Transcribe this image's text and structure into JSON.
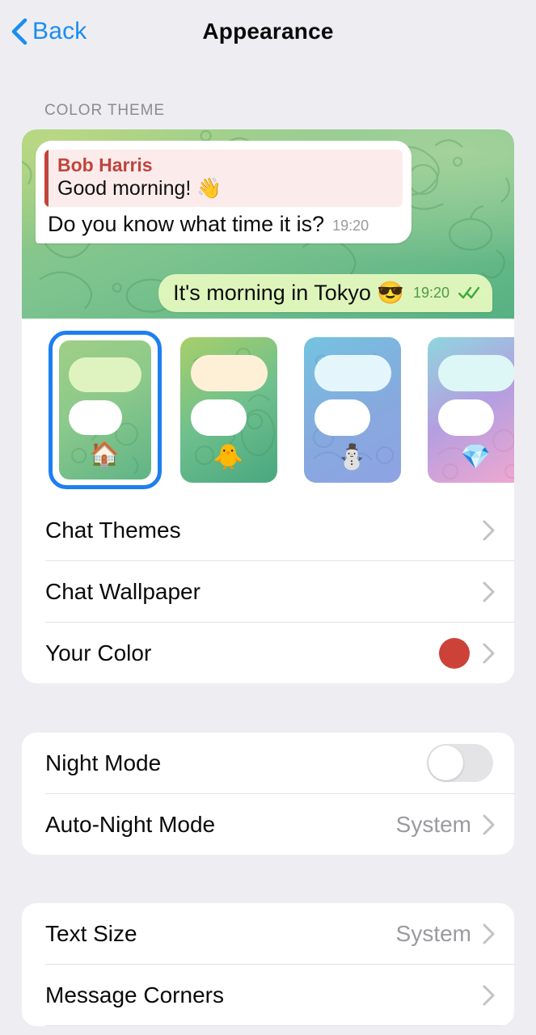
{
  "nav": {
    "back_label": "Back",
    "back_icon": "chevron-left-icon",
    "title": "Appearance"
  },
  "color_theme": {
    "header": "COLOR THEME",
    "preview": {
      "incoming": {
        "reply_name": "Bob Harris",
        "reply_text": "Good morning! 👋",
        "text": "Do you know what time it is?",
        "time": "19:20"
      },
      "outgoing": {
        "text": "It's morning in Tokyo 😎",
        "time": "19:20",
        "status_icon": "double-check-icon"
      }
    },
    "swatches": [
      {
        "name": "green-home-theme",
        "emoji": "🏠",
        "selected": true,
        "bg": "linear-gradient(150deg,#9fcf86 0%,#8cc98b 45%,#5fb487 100%)",
        "bubble1": "#dff3c0"
      },
      {
        "name": "green-chick-theme",
        "emoji": "🐥",
        "selected": false,
        "bg": "linear-gradient(150deg,#a8cf6a 0%,#6fc08d 50%,#49a77f 100%)",
        "bubble1": "#fdf0d6"
      },
      {
        "name": "blue-snowman-theme",
        "emoji": "⛄",
        "selected": false,
        "bg": "linear-gradient(150deg,#74c3e0 0%,#86a9de 55%,#8fa3e3 100%)",
        "bubble1": "#e4f6fc"
      },
      {
        "name": "pink-gem-theme",
        "emoji": "💎",
        "selected": false,
        "bg": "linear-gradient(150deg,#8fd6de 0%,#b49ee0 48%,#f3a8cf 100%)",
        "bubble1": "#ddf7f6"
      }
    ],
    "rows": [
      {
        "label": "Chat Themes",
        "name": "chat-themes",
        "value": ""
      },
      {
        "label": "Chat Wallpaper",
        "name": "chat-wallpaper",
        "value": ""
      },
      {
        "label": "Your Color",
        "name": "your-color",
        "value": "",
        "dot": "#cc4138"
      }
    ]
  },
  "night": {
    "night_mode_label": "Night Mode",
    "night_mode_on": false,
    "auto_night_label": "Auto-Night Mode",
    "auto_night_value": "System"
  },
  "text_section": {
    "text_size_label": "Text Size",
    "text_size_value": "System",
    "message_corners_label": "Message Corners"
  },
  "colors": {
    "accent": "#1b8cf3",
    "selection_ring": "#1d7ff0",
    "your_color_dot": "#cc4138",
    "page_bg": "#eeeef2",
    "card_bg": "#ffffff"
  }
}
